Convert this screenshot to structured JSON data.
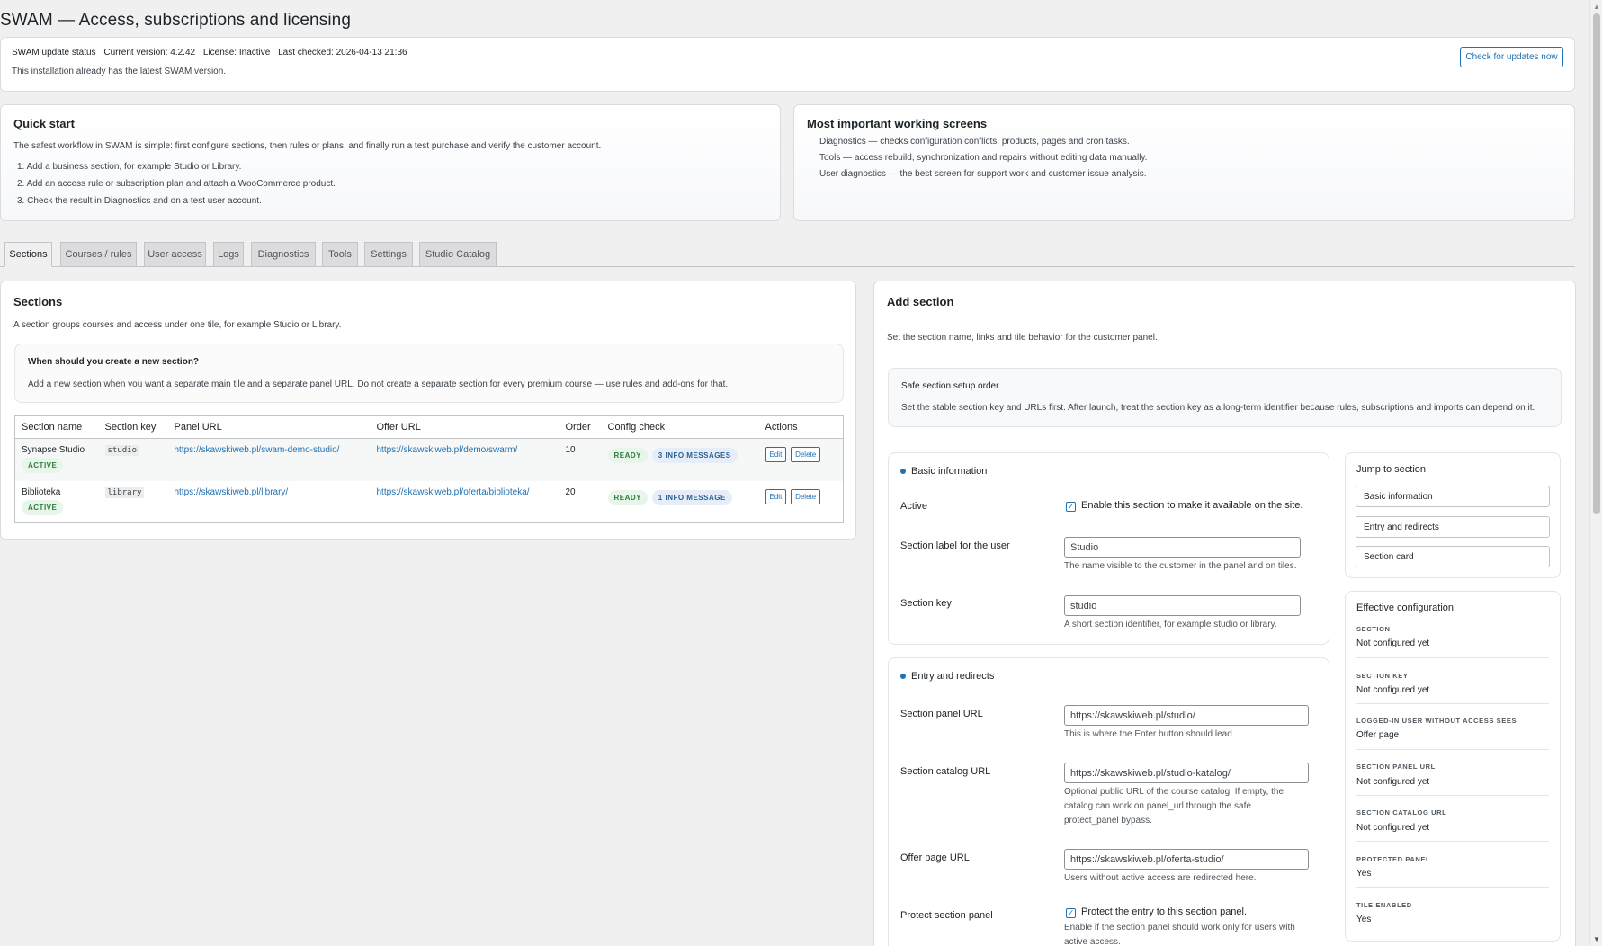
{
  "page": {
    "title": "SWAM — Access, subscriptions and licensing"
  },
  "update_status": {
    "label": "SWAM update status",
    "current_version": "Current version: 4.2.42",
    "license": "License: Inactive",
    "last_checked": "Last checked: 2026-04-13 21:36",
    "message": "This installation already has the latest SWAM version.",
    "check_button": "Check for updates now"
  },
  "quick_start": {
    "title": "Quick start",
    "intro": "The safest workflow in SWAM is simple: first configure sections, then rules or plans, and finally run a test purchase and verify the customer account.",
    "steps": [
      "1. Add a business section, for example Studio or Library.",
      "2. Add an access rule or subscription plan and attach a WooCommerce product.",
      "3. Check the result in Diagnostics and on a test user account."
    ]
  },
  "working_screens": {
    "title": "Most important working screens",
    "items": [
      "Diagnostics — checks configuration conflicts, products, pages and cron tasks.",
      "Tools — access rebuild, synchronization and repairs without editing data manually.",
      "User diagnostics — the best screen for support work and customer issue analysis."
    ]
  },
  "tabs": [
    "Sections",
    "Courses / rules",
    "User access",
    "Logs",
    "Diagnostics",
    "Tools",
    "Settings",
    "Studio Catalog"
  ],
  "sections_panel": {
    "title": "Sections",
    "description": "A section groups courses and access under one tile, for example Studio or Library.",
    "info_title": "When should you create a new section?",
    "info_text": "Add a new section when you want a separate main tile and a separate panel URL. Do not create a separate section for every premium course — use rules and add-ons for that.",
    "columns": [
      "Section name",
      "Section key",
      "Panel URL",
      "Offer URL",
      "Order",
      "Config check",
      "Actions"
    ],
    "rows": [
      {
        "name": "Synapse Studio",
        "status": "ACTIVE",
        "key": "studio",
        "panel_url": "https://skawskiweb.pl/swam-demo-studio/",
        "offer_url": "https://skawskiweb.pl/demo/swarm/",
        "order": "10",
        "check": "READY",
        "messages": "3 INFO MESSAGES",
        "edit": "Edit",
        "delete": "Delete"
      },
      {
        "name": "Biblioteka",
        "status": "ACTIVE",
        "key": "library",
        "panel_url": "https://skawskiweb.pl/library/",
        "offer_url": "https://skawskiweb.pl/oferta/biblioteka/",
        "order": "20",
        "check": "READY",
        "messages": "1 INFO MESSAGE",
        "edit": "Edit",
        "delete": "Delete"
      }
    ]
  },
  "add_section": {
    "title": "Add section",
    "description": "Set the section name, links and tile behavior for the customer panel.",
    "safe_title": "Safe section setup order",
    "safe_text": "Set the stable section key and URLs first. After launch, treat the section key as a long-term identifier because rules, subscriptions and imports can depend on it.",
    "basic": {
      "title": "Basic information",
      "active_label": "Active",
      "active_text": "Enable this section to make it available on the site.",
      "label_label": "Section label for the user",
      "label_value": "Studio",
      "label_help": "The name visible to the customer in the panel and on tiles.",
      "key_label": "Section key",
      "key_value": "studio",
      "key_help": "A short section identifier, for example studio or library."
    },
    "entry": {
      "title": "Entry and redirects",
      "panel_label": "Section panel URL",
      "panel_value": "https://skawskiweb.pl/studio/",
      "panel_help": "This is where the Enter button should lead.",
      "catalog_label": "Section catalog URL",
      "catalog_value": "https://skawskiweb.pl/studio-katalog/",
      "catalog_help_1": "Optional public URL of the course catalog. If empty, the",
      "catalog_help_2": "catalog can work on panel_url through the safe",
      "catalog_help_3": "protect_panel bypass.",
      "offer_label": "Offer page URL",
      "offer_value": "https://skawskiweb.pl/oferta-studio/",
      "offer_help": "Users without active access are redirected here.",
      "protect_label": "Protect section panel",
      "protect_text": "Protect the entry to this section panel.",
      "protect_help_1": "Enable if the section panel should work only for users with",
      "protect_help_2": "active access."
    },
    "jump": {
      "title": "Jump to section",
      "items": [
        "Basic information",
        "Entry and redirects",
        "Section card"
      ]
    },
    "effective": {
      "title": "Effective configuration",
      "items": [
        {
          "key": "SECTION",
          "value": "Not configured yet"
        },
        {
          "key": "SECTION KEY",
          "value": "Not configured yet"
        },
        {
          "key": "LOGGED-IN USER WITHOUT ACCESS SEES",
          "value": "Offer page"
        },
        {
          "key": "SECTION PANEL URL",
          "value": "Not configured yet"
        },
        {
          "key": "SECTION CATALOG URL",
          "value": "Not configured yet"
        },
        {
          "key": "PROTECTED PANEL",
          "value": "Yes"
        },
        {
          "key": "TILE ENABLED",
          "value": "Yes"
        }
      ]
    }
  },
  "icons": {
    "checkbox": "check-icon",
    "scroll_up": "arrow-up-icon",
    "scroll_down": "arrow-down-icon"
  },
  "colors": {
    "accent": "#2271b1",
    "ready": "#2f7d3d",
    "info": "#2a5f91"
  }
}
